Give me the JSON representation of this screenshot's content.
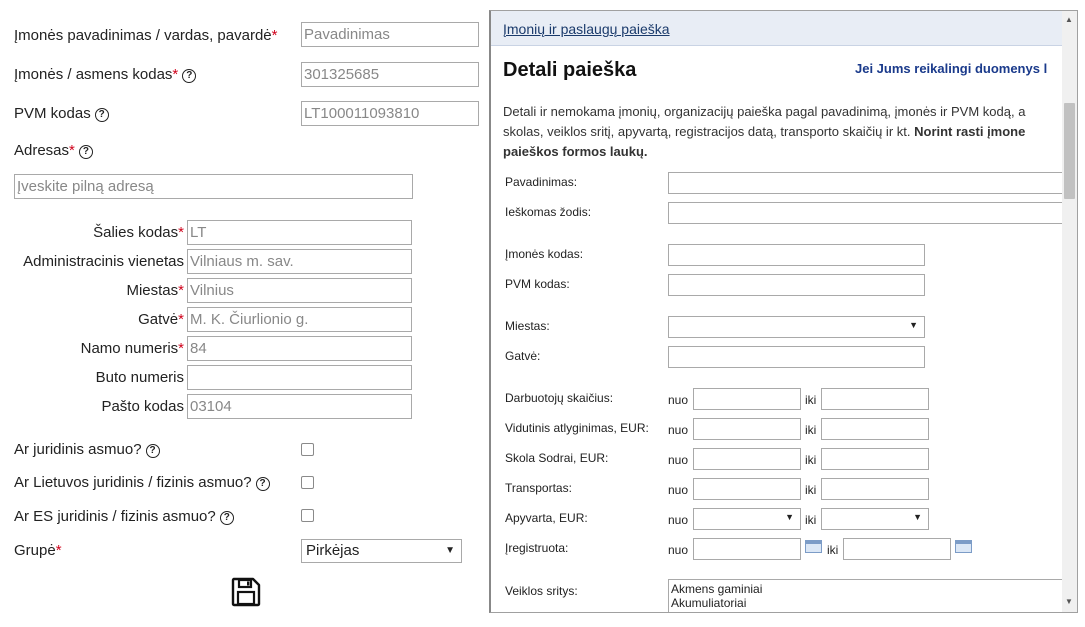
{
  "form": {
    "company_name": {
      "label": "Įmonės pavadinimas / vardas, pavardė",
      "placeholder": "Pavadinimas"
    },
    "company_code": {
      "label": "Įmonės / asmens kodas",
      "value": "301325685"
    },
    "vat_code": {
      "label": "PVM kodas",
      "value": "LT100011093810"
    },
    "address": {
      "label": "Adresas",
      "placeholder": "Įveskite pilną adresą"
    },
    "address_fields": [
      {
        "label": "Šalies kodas",
        "required": true,
        "value": "LT"
      },
      {
        "label": "Administracinis vienetas",
        "required": false,
        "value": "Vilniaus m. sav."
      },
      {
        "label": "Miestas",
        "required": true,
        "value": "Vilnius"
      },
      {
        "label": "Gatvė",
        "required": true,
        "value": "M. K. Čiurlionio g."
      },
      {
        "label": "Namo numeris",
        "required": true,
        "value": "84"
      },
      {
        "label": "Buto numeris",
        "required": false,
        "value": ""
      },
      {
        "label": "Pašto kodas",
        "required": false,
        "value": "03104"
      }
    ],
    "is_legal": {
      "label": "Ar juridinis asmuo?"
    },
    "is_lt": {
      "label": "Ar Lietuvos juridinis / fizinis asmuo?"
    },
    "is_eu": {
      "label": "Ar ES juridinis / fizinis asmuo?"
    },
    "group": {
      "label": "Grupė",
      "value": "Pirkėjas"
    },
    "required_mark": "*",
    "help_glyph": "?",
    "save_icon": "floppy-disk-icon"
  },
  "panel": {
    "header_link": "Įmonių ir paslaugų paieška",
    "title": "Detali paieška",
    "promo_link": "Jei Jums reikalingi duomenys l",
    "desc_1": "Detali ir nemokama įmonių, organizacijų paieška pagal pavadinimą, įmonės ir PVM kodą, a",
    "desc_2": "skolas, veiklos sritį, apyvartą, registracijos datą, transporto skaičių ir kt.",
    "desc_2_bold": "Norint rasti įmone",
    "desc_3_bold": "paieškos formos laukų.",
    "labels": {
      "name": "Pavadinimas:",
      "keyword": "Ieškomas žodis:",
      "code": "Įmonės kodas:",
      "vat": "PVM kodas:",
      "city": "Miestas:",
      "street": "Gatvė:",
      "employees": "Darbuotojų skaičius:",
      "salary": "Vidutinis atlyginimas, EUR:",
      "sodra": "Skola Sodrai, EUR:",
      "transport": "Transportas:",
      "turnover": "Apyvarta, EUR:",
      "registered": "Įregistruota:",
      "activity": "Veiklos sritys:"
    },
    "from": "nuo",
    "to": "iki",
    "activity_options": [
      "Akmens gaminiai",
      "Akumuliatoriai"
    ]
  }
}
